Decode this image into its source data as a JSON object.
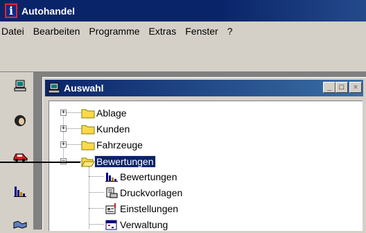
{
  "app": {
    "title": "Autohandel",
    "icon": "info-i-icon"
  },
  "menu": [
    "Datei",
    "Bearbeiten",
    "Programme",
    "Extras",
    "Fenster",
    "?"
  ],
  "left_toolbar": {
    "items": [
      "computer-icon",
      "customer-head-icon",
      "car-icon",
      "bar-chart-icon",
      "handshake-icon"
    ]
  },
  "child_window": {
    "title": "Auswahl",
    "buttons": {
      "minimize": "_",
      "maximize": "□",
      "close": "×"
    }
  },
  "tree": {
    "roots": [
      {
        "label": "Ablage",
        "expander": "+"
      },
      {
        "label": "Kunden",
        "expander": "+"
      },
      {
        "label": "Fahrzeuge",
        "expander": "+"
      },
      {
        "label": "Bewertungen",
        "expander": "−",
        "selected": true,
        "children": [
          {
            "label": "Bewertungen",
            "icon": "bar-chart-icon"
          },
          {
            "label": "Druckvorlagen",
            "icon": "print-template-icon"
          },
          {
            "label": "Einstellungen",
            "icon": "settings-icon"
          },
          {
            "label": "Verwaltung",
            "icon": "calendar-admin-icon"
          }
        ]
      }
    ]
  },
  "colors": {
    "title_bar": "#0a246a",
    "selection": "#0a246a",
    "folder": "#ffd94a",
    "background": "#d4d0c8"
  }
}
